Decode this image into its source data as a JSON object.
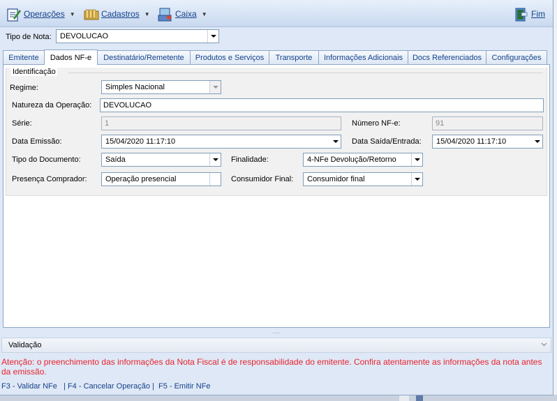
{
  "menu": {
    "operacoes": "Operações",
    "cadastros": "Cadastros",
    "caixa": "Caixa",
    "fim": "Fim"
  },
  "tipo_nota": {
    "label": "Tipo de Nota:",
    "value": "DEVOLUCAO"
  },
  "tabs": [
    "Emitente",
    "Dados NF-e",
    "Destinatário/Remetente",
    "Produtos e Serviços",
    "Transporte",
    "Informações Adicionais",
    "Docs Referenciados",
    "Configurações"
  ],
  "active_tab": "Dados NF-e",
  "identificacao": {
    "title": "Identificação",
    "regime": {
      "label": "Regime:",
      "value": "Simples Nacional"
    },
    "natureza": {
      "label": "Natureza da Operação:",
      "value": "DEVOLUCAO"
    },
    "serie": {
      "label": "Série:",
      "value": "1"
    },
    "numero": {
      "label": "Número NF-e:",
      "value": "91"
    },
    "data_emissao": {
      "label": "Data Emissão:",
      "value": "15/04/2020 11:17:10"
    },
    "data_saida": {
      "label": "Data Saída/Entrada:",
      "value": "15/04/2020 11:17:10"
    },
    "tipo_documento": {
      "label": "Tipo do Documento:",
      "value": "Saída"
    },
    "finalidade": {
      "label": "Finalidade:",
      "value": "4-NFe Devolução/Retorno"
    },
    "presenca": {
      "label": "Presença Comprador:",
      "value": "Operação presencial"
    },
    "consumidor": {
      "label": "Consumidor Final:",
      "value": "Consumidor final"
    }
  },
  "splitter": "......",
  "validacao": "Validação",
  "warning": "Atenção: o preenchimento das informações da Nota Fiscal é de responsabilidade do emitente. Confira atentamente as informações da nota antes da emissão.",
  "status": "F3 - Validar NFe   | F4 - Cancelar Operação |  F5 - Emitir NFe",
  "colors": {
    "accent": "#15428b",
    "warning": "#e8222c",
    "menubar": "#c9d9ef"
  }
}
